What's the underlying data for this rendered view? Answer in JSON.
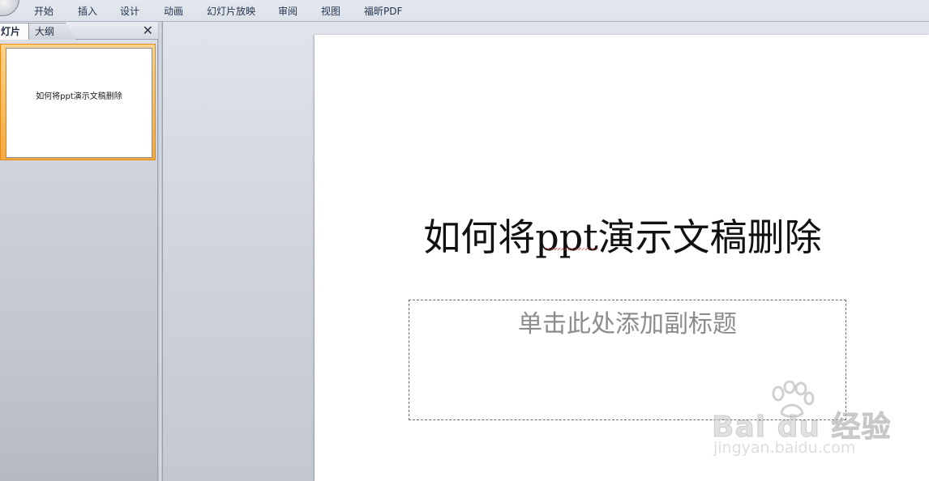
{
  "ribbon": {
    "tabs": [
      "开始",
      "插入",
      "设计",
      "动画",
      "幻灯片放映",
      "审阅",
      "视图",
      "福昕PDF"
    ]
  },
  "left_panel": {
    "tab_slides": "灯片",
    "tab_outline": "大纲",
    "close_symbol": "✕",
    "thumbnail_title": "如何将ppt演示文稿删除"
  },
  "slide": {
    "title": "如何将ppt演示文稿删除",
    "subtitle_placeholder": "单击此处添加副标题"
  },
  "watermark": {
    "logo": "Bai du 经验",
    "url": "jingyan.baidu.com"
  },
  "colors": {
    "selection_orange": "#f3a940",
    "spell_underline": "#d12a2a"
  }
}
